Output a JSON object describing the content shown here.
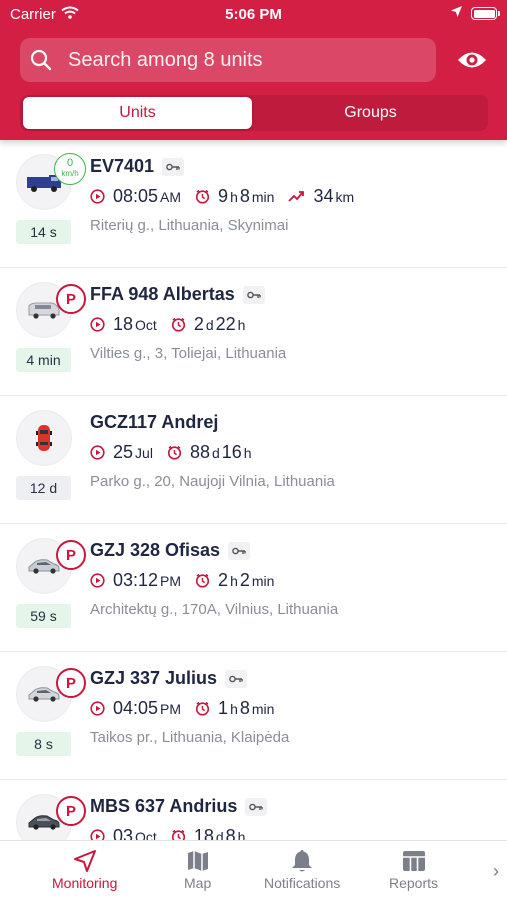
{
  "status_bar": {
    "carrier": "Carrier",
    "time": "5:06 PM"
  },
  "search": {
    "placeholder": "Search among 8 units"
  },
  "segments": {
    "units": "Units",
    "groups": "Groups"
  },
  "units": [
    {
      "name": "EV7401",
      "badge": "speed",
      "speed": "0",
      "speed_unit": "km/h",
      "age": "14 s",
      "age_color": "green",
      "icon": "van-icon",
      "has_key": true,
      "stats": [
        {
          "icon": "play",
          "value": "08:05",
          "unit": " AM"
        },
        {
          "icon": "clock",
          "value": "9",
          "unit": "h",
          "value2": " 8",
          "unit2": "min"
        },
        {
          "icon": "trend",
          "value": "34",
          "unit": "km"
        }
      ],
      "address": "Riterių g., Lithuania, Skynimai"
    },
    {
      "name": "FFA 948 Albertas",
      "badge": "P",
      "age": "4 min",
      "age_color": "green",
      "icon": "minivan-icon",
      "has_key": true,
      "stats": [
        {
          "icon": "play",
          "value": "18",
          "unit": " Oct"
        },
        {
          "icon": "clock",
          "value": "2",
          "unit": "d",
          "value2": " 22",
          "unit2": "h"
        }
      ],
      "address": "Vilties g., 3, Toliejai, Lithuania"
    },
    {
      "name": "GCZ117 Andrej",
      "badge": "",
      "age": "12 d",
      "age_color": "gray",
      "icon": "red-car-icon",
      "has_key": false,
      "stats": [
        {
          "icon": "play",
          "value": "25",
          "unit": " Jul"
        },
        {
          "icon": "clock",
          "value": "88",
          "unit": "d",
          "value2": " 16",
          "unit2": "h"
        }
      ],
      "address": "Parko g., 20, Naujoji Vilnia, Lithuania"
    },
    {
      "name": "GZJ 328 Ofisas",
      "badge": "P",
      "age": "59 s",
      "age_color": "green",
      "icon": "silver-car-icon",
      "has_key": true,
      "stats": [
        {
          "icon": "play",
          "value": "03:12",
          "unit": " PM"
        },
        {
          "icon": "clock",
          "value": "2",
          "unit": "h",
          "value2": " 2",
          "unit2": "min"
        }
      ],
      "address": "Architektų g., 170A, Vilnius, Lithuania"
    },
    {
      "name": "GZJ 337 Julius",
      "badge": "P",
      "age": "8 s",
      "age_color": "green",
      "icon": "silver-car-icon",
      "has_key": true,
      "stats": [
        {
          "icon": "play",
          "value": "04:05",
          "unit": " PM"
        },
        {
          "icon": "clock",
          "value": "1",
          "unit": "h",
          "value2": " 8",
          "unit2": "min"
        }
      ],
      "address": "Taikos pr., Lithuania, Klaipėda"
    },
    {
      "name": "MBS 637 Andrius",
      "badge": "P",
      "age": "",
      "age_color": "green",
      "icon": "dark-car-icon",
      "has_key": true,
      "stats": [
        {
          "icon": "play",
          "value": "03",
          "unit": " Oct"
        },
        {
          "icon": "clock",
          "value": "18",
          "unit": "d",
          "value2": " 8",
          "unit2": "h"
        }
      ],
      "address": ""
    }
  ],
  "tabbar": {
    "monitoring": "Monitoring",
    "map": "Map",
    "notifications": "Notifications",
    "reports": "Reports",
    "more": "›"
  },
  "colors": {
    "brand": "#d41f45",
    "accent": "#c8173d",
    "moving": "#3cb44b"
  }
}
